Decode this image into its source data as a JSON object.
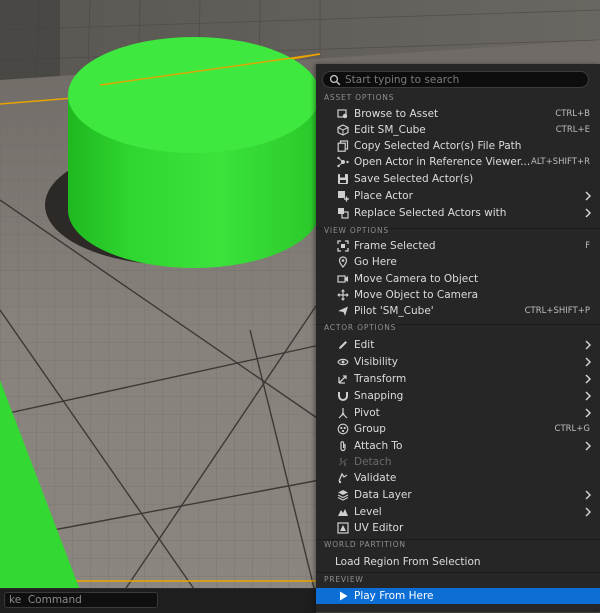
{
  "console": {
    "placeholder": "Command",
    "visible_prefix": "ke"
  },
  "search": {
    "placeholder": "Start typing to search"
  },
  "sections": [
    {
      "header": "ASSET OPTIONS"
    },
    {
      "header": "VIEW OPTIONS"
    },
    {
      "header": "ACTOR OPTIONS"
    },
    {
      "header": "WORLD PARTITION"
    },
    {
      "header": "PREVIEW"
    }
  ],
  "items": [
    {
      "label": "Browse to Asset",
      "shortcut": "CTRL+B",
      "icon": "browse-icon"
    },
    {
      "label": "Edit SM_Cube",
      "shortcut": "CTRL+E",
      "icon": "cube-edit-icon"
    },
    {
      "label": "Copy Selected Actor(s) File Path",
      "shortcut": "",
      "icon": "copy-icon"
    },
    {
      "label": "Open Actor in Reference Viewer...",
      "shortcut": "ALT+SHIFT+R",
      "icon": "reference-viewer-icon"
    },
    {
      "label": "Save Selected Actor(s)",
      "shortcut": "",
      "icon": "save-icon"
    },
    {
      "label": "Place Actor",
      "shortcut": "",
      "icon": "place-actor-icon",
      "submenu": true
    },
    {
      "label": "Replace Selected Actors with",
      "shortcut": "",
      "icon": "replace-icon",
      "submenu": true
    },
    {
      "label": "Frame Selected",
      "shortcut": "F",
      "icon": "frame-icon"
    },
    {
      "label": "Go Here",
      "shortcut": "",
      "icon": "go-here-icon"
    },
    {
      "label": "Move Camera to Object",
      "shortcut": "",
      "icon": "move-camera-icon"
    },
    {
      "label": "Move Object to Camera",
      "shortcut": "",
      "icon": "move-object-icon"
    },
    {
      "label": "Pilot 'SM_Cube'",
      "shortcut": "CTRL+SHIFT+P",
      "icon": "pilot-icon"
    },
    {
      "label": "Edit",
      "shortcut": "",
      "icon": "pencil-icon",
      "submenu": true
    },
    {
      "label": "Visibility",
      "shortcut": "",
      "icon": "eye-icon",
      "submenu": true
    },
    {
      "label": "Transform",
      "shortcut": "",
      "icon": "transform-icon",
      "submenu": true
    },
    {
      "label": "Snapping",
      "shortcut": "",
      "icon": "magnet-icon",
      "submenu": true
    },
    {
      "label": "Pivot",
      "shortcut": "",
      "icon": "pivot-icon",
      "submenu": true
    },
    {
      "label": "Group",
      "shortcut": "CTRL+G",
      "icon": "group-icon"
    },
    {
      "label": "Attach To",
      "shortcut": "",
      "icon": "attach-icon",
      "submenu": true
    },
    {
      "label": "Detach",
      "shortcut": "",
      "icon": "detach-icon",
      "disabled": true
    },
    {
      "label": "Validate",
      "shortcut": "",
      "icon": "validate-icon"
    },
    {
      "label": "Data Layer",
      "shortcut": "",
      "icon": "layers-icon",
      "submenu": true
    },
    {
      "label": "Level",
      "shortcut": "",
      "icon": "level-icon",
      "submenu": true
    },
    {
      "label": "UV Editor",
      "shortcut": "",
      "icon": "uv-editor-icon"
    },
    {
      "label": "Load Region From Selection",
      "shortcut": "",
      "icon": ""
    },
    {
      "label": "Play From Here",
      "shortcut": "",
      "icon": "play-icon",
      "selected": true
    }
  ],
  "colors": {
    "menu_bg": "#262626",
    "highlight": "#0d6fd6",
    "text": "#dcdcdc",
    "section_text": "#8e8e8e",
    "cylinder_green": "#35e335",
    "floor": "#868079",
    "selection_outline": "#e8a300"
  }
}
